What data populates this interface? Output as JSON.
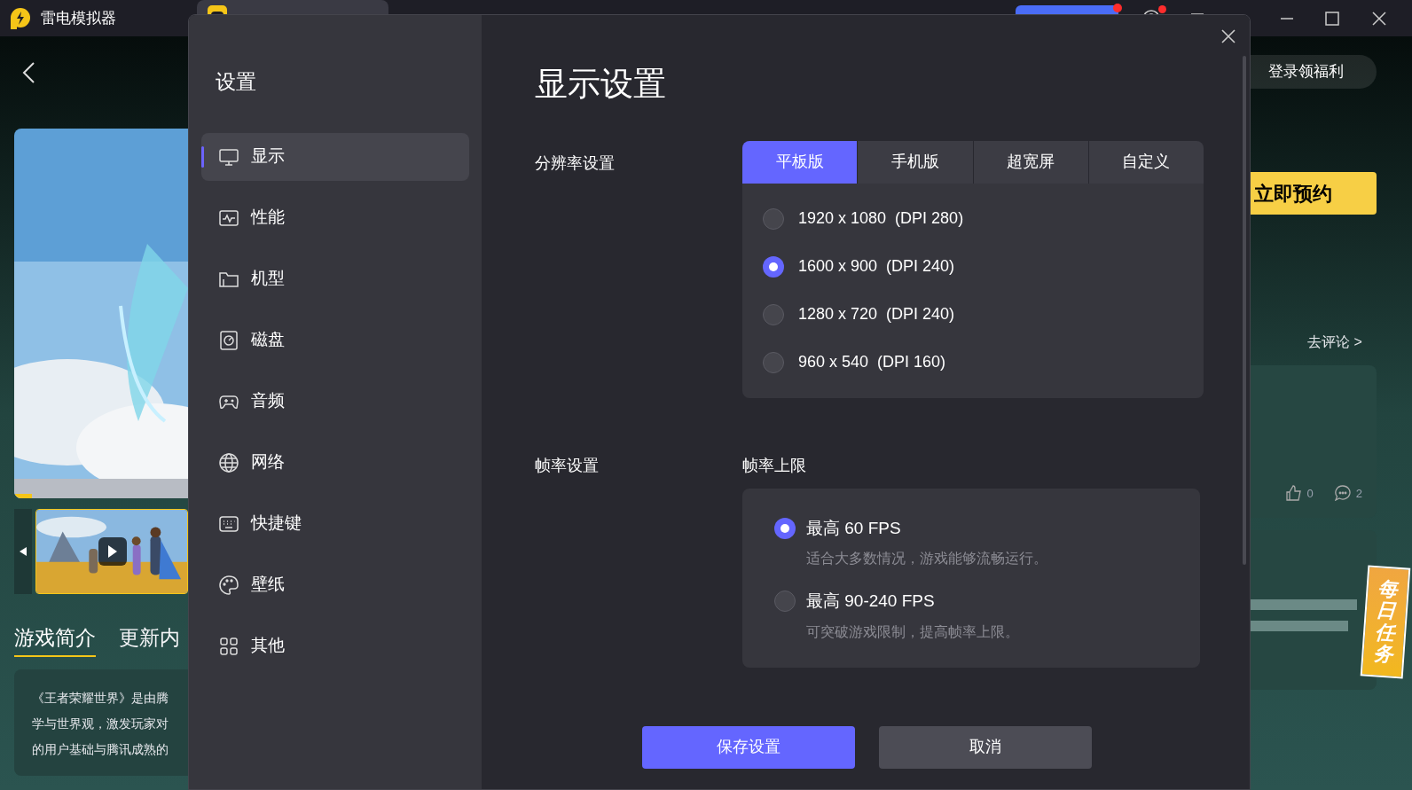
{
  "app": {
    "title": "雷电模拟器"
  },
  "background": {
    "tabs": [
      {
        "label": "游戏简介",
        "selected": true
      },
      {
        "label": "更新内",
        "selected": false
      }
    ],
    "description": [
      "《王者荣耀世界》是由腾",
      "学与世界观，激发玩家对",
      "的用户基础与腾讯成熟的"
    ],
    "login": "登录领福利",
    "reserve": "立即预约",
    "review_link": "去评论 >",
    "likes": "0",
    "comments": "2",
    "daily_task": "每日任务"
  },
  "settings": {
    "title": "设置",
    "nav": [
      {
        "label": "显示",
        "selected": true
      },
      {
        "label": "性能",
        "selected": false
      },
      {
        "label": "机型",
        "selected": false
      },
      {
        "label": "磁盘",
        "selected": false
      },
      {
        "label": "音频",
        "selected": false
      },
      {
        "label": "网络",
        "selected": false
      },
      {
        "label": "快捷键",
        "selected": false
      },
      {
        "label": "壁纸",
        "selected": false
      },
      {
        "label": "其他",
        "selected": false
      }
    ],
    "heading": "显示设置",
    "resolution": {
      "label": "分辨率设置",
      "tabs": [
        {
          "label": "平板版",
          "selected": true
        },
        {
          "label": "手机版",
          "selected": false
        },
        {
          "label": "超宽屏",
          "selected": false
        },
        {
          "label": "自定义",
          "selected": false
        }
      ],
      "options": [
        {
          "size": "1920 x 1080",
          "dpi": "(DPI 280)",
          "selected": false
        },
        {
          "size": "1600 x 900",
          "dpi": "(DPI 240)",
          "selected": true
        },
        {
          "size": "1280 x 720",
          "dpi": "(DPI 240)",
          "selected": false
        },
        {
          "size": "960 x 540",
          "dpi": "(DPI 160)",
          "selected": false
        }
      ]
    },
    "framerate": {
      "label": "帧率设置",
      "sublabel": "帧率上限",
      "options": [
        {
          "label": "最高 60 FPS",
          "description": "适合大多数情况，游戏能够流畅运行。",
          "selected": true
        },
        {
          "label": "最高 90-240 FPS",
          "description": "可突破游戏限制，提高帧率上限。",
          "selected": false
        }
      ]
    },
    "buttons": [
      {
        "label": "保存设置",
        "kind": "primary"
      },
      {
        "label": "取消",
        "kind": "secondary"
      }
    ]
  }
}
